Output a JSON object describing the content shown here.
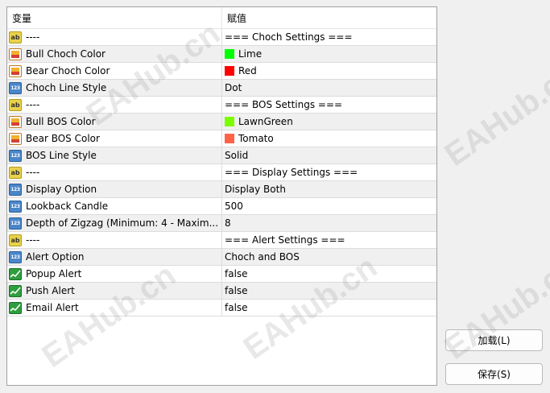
{
  "header": {
    "name_col": "变量",
    "value_col": "赋值"
  },
  "rows": [
    {
      "type": "ab",
      "icon": "string-type-icon",
      "name": "----",
      "value": "=== Choch Settings ==="
    },
    {
      "type": "color",
      "icon": "color-type-icon",
      "name": "Bull Choch Color",
      "value": "Lime",
      "swatch": "#00ff00"
    },
    {
      "type": "color",
      "icon": "color-type-icon",
      "name": "Bear Choch Color",
      "value": "Red",
      "swatch": "#ff0000"
    },
    {
      "type": "num",
      "icon": "enum-type-icon",
      "name": "Choch Line Style",
      "value": "Dot"
    },
    {
      "type": "ab",
      "icon": "string-type-icon",
      "name": "----",
      "value": "=== BOS Settings ==="
    },
    {
      "type": "color",
      "icon": "color-type-icon",
      "name": "Bull BOS Color",
      "value": "LawnGreen",
      "swatch": "#7cfc00"
    },
    {
      "type": "color",
      "icon": "color-type-icon",
      "name": "Bear BOS Color",
      "value": "Tomato",
      "swatch": "#ff6347"
    },
    {
      "type": "num",
      "icon": "enum-type-icon",
      "name": "BOS Line Style",
      "value": "Solid"
    },
    {
      "type": "ab",
      "icon": "string-type-icon",
      "name": "----",
      "value": "=== Display Settings ==="
    },
    {
      "type": "num",
      "icon": "enum-type-icon",
      "name": "Display Option",
      "value": "Display Both"
    },
    {
      "type": "num",
      "icon": "integer-type-icon",
      "name": "Lookback Candle",
      "value": "500"
    },
    {
      "type": "num",
      "icon": "integer-type-icon",
      "name": "Depth of Zigzag (Minimum: 4  -  Maxim...",
      "value": "8"
    },
    {
      "type": "ab",
      "icon": "string-type-icon",
      "name": "----",
      "value": "=== Alert Settings ==="
    },
    {
      "type": "num",
      "icon": "enum-type-icon",
      "name": "Alert Option",
      "value": "Choch and BOS"
    },
    {
      "type": "bool",
      "icon": "boolean-type-icon",
      "name": "Popup Alert",
      "value": "false"
    },
    {
      "type": "bool",
      "icon": "boolean-type-icon",
      "name": "Push Alert",
      "value": "false"
    },
    {
      "type": "bool",
      "icon": "boolean-type-icon",
      "name": "Email Alert",
      "value": "false"
    }
  ],
  "icon_labels": {
    "ab": "ab",
    "num": "123"
  },
  "buttons": {
    "load": "加载(L)",
    "save": "保存(S)"
  },
  "watermark": "EAHub.cn"
}
